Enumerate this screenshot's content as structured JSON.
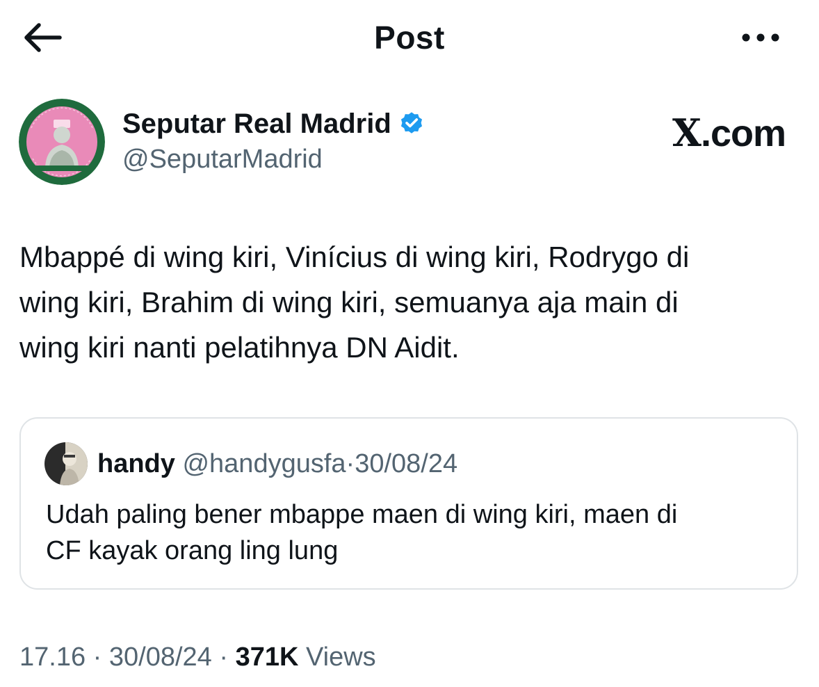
{
  "header": {
    "title": "Post",
    "back_icon": "arrow-left-icon",
    "more_icon": "more-horizontal-icon"
  },
  "tweet": {
    "display_name": "Seputar Real Madrid",
    "handle": "@SeputarMadrid",
    "verified_icon": "verified-badge-icon",
    "verified_color": "#1d9bf0",
    "avatar_colors": {
      "ring": "#1f6b3d",
      "fill": "#e98ab8"
    },
    "watermark": {
      "x": "X",
      "rest": ".com"
    },
    "text": "Mbappé di wing kiri, Vinícius di wing kiri, Rodrygo di\nwing kiri, Brahim di wing kiri, semuanya aja main di\nwing kiri nanti pelatihnya DN Aidit."
  },
  "quote": {
    "display_name": "handy",
    "handle": "@handygusfa",
    "separator": "·",
    "date": "30/08/24",
    "text": "Udah paling bener mbappe maen di wing kiri, maen di\nCF kayak orang ling lung"
  },
  "meta": {
    "time": "17.16",
    "separator": "·",
    "date": "30/08/24",
    "views_count": "371K",
    "views_label": "Views"
  },
  "colors": {
    "text_primary": "#0f1419",
    "text_secondary": "#536471",
    "border": "#dfe3e6"
  }
}
